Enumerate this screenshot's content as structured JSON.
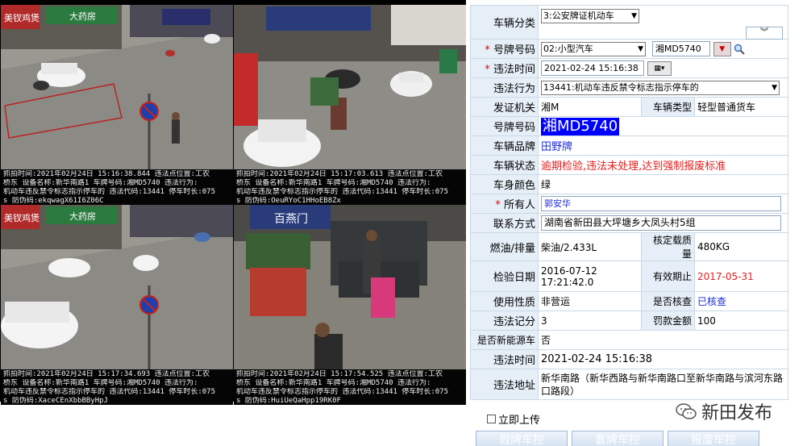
{
  "photos": [
    {
      "line1": "抓拍时间:2021年02月24日 15:16:38.844 违法点位置:工农",
      "line2": "桥东 设备名称:新华南路1 车牌号码:湘MD5740 违法行为:",
      "line3": "机动车违反禁令标志指示停车的 违法代码:13441 停车时长:075",
      "line4": "s 防伪码:ekqwagX61I6Z06C"
    },
    {
      "line1": "抓拍时间:2021年02月24日 15:17:03.613 违法点位置:工农",
      "line2": "桥东 设备名称:新华南路1 车牌号码:湘MD5740 违法行为:",
      "line3": "机动车违反禁令标志指示停车的 违法代码:13441 停车时长:075",
      "line4": "s 防伪码:OeuRYoC1HHoEB8Zx"
    },
    {
      "line1": "抓拍时间:2021年02月24日 15:17:34.693 违法点位置:工农",
      "line2": "桥东 设备名称:新华南路1 车牌号码:湘MD5740 违法行为:",
      "line3": "机动车违反禁令标志指示停车的 违法代码:13441 停车时长:075",
      "line4": "s 防伪码:XaceCEnXbbBByHpJ"
    },
    {
      "line1": "抓拍时间:2021年02月24日 15:17:54.525 违法点位置:工农",
      "line2": "桥东 设备名称:新华南路1 车牌号码:湘MD5740 违法行为:",
      "line3": "机动车违反禁令标志指示停车的 违法代码:13441 停车时长:075",
      "line4": "s 防伪码:HuiUeQaHpp19RK0F"
    }
  ],
  "scene_text": {
    "shop1": "美钗鸡煲",
    "shop_pharmacy": "大药房",
    "shop2": "百燕门"
  },
  "form": {
    "vehicle_category_label": "车辆分类",
    "vehicle_category_value": "3:公安牌证机动车",
    "plate_type_label": "号牌号码",
    "plate_type_value": "02:小型汽车",
    "plate_input_value": "湘MD5740",
    "violation_time_label": "违法时间",
    "violation_time_value": "2021-02-24 15:16:38",
    "violation_act_label": "违法行为",
    "violation_act_value": "13441:机动车违反禁令标志指示停车的",
    "issuing_authority_label": "发证机关",
    "issuing_authority_value": "湘M",
    "vehicle_type_label": "车辆类型",
    "vehicle_type_value": "轻型普通货车",
    "plate_number_label": "号牌号码",
    "plate_number_value": "湘MD5740",
    "brand_label": "车辆品牌",
    "brand_value": "田野牌",
    "status_label": "车辆状态",
    "status_value": "逾期检验,违法未处理,达到强制报废标准",
    "color_label": "车身颜色",
    "color_value": "绿",
    "owner_label": "所有人",
    "owner_value": "郭安华",
    "contact_label": "联系方式",
    "contact_value": "湖南省新田县大坪塘乡大凤头村5组",
    "fuel_label": "燃油/排量",
    "fuel_value": "柴油/2.433L",
    "load_label": "核定载质量",
    "load_value": "480KG",
    "inspect_date_label": "检验日期",
    "inspect_date_value1": "2016-07-12",
    "inspect_date_value2": "17:21:42.0",
    "valid_until_label": "有效期止",
    "valid_until_value": "2017-05-31",
    "usage_label": "使用性质",
    "usage_value": "非营运",
    "checked_label": "是否核查",
    "checked_value": "已核查",
    "points_label": "违法记分",
    "points_value": "3",
    "fine_label": "罚款金额",
    "fine_value": "100",
    "new_energy_label": "是否新能源车",
    "new_energy_value": "否",
    "violation_time2_label": "违法时间",
    "violation_time2_value": "2021-02-24 15:16:38",
    "violation_place_label": "违法地址",
    "violation_place_value": "新华南路（新华西路与新华南路口至新华南路与滨河东路口路段）"
  },
  "bottom": {
    "upload_label": "立即上传",
    "btn_fake": "假牌车控",
    "btn_cloned": "套牌车控",
    "btn_scrap": "报废车控",
    "watermark": "新田发布"
  },
  "colors": {
    "label_bg": "#e6eff8",
    "red_text": "#e31d1d",
    "blue_text": "#1f2fd6",
    "plate_highlight": "#0000ff"
  }
}
